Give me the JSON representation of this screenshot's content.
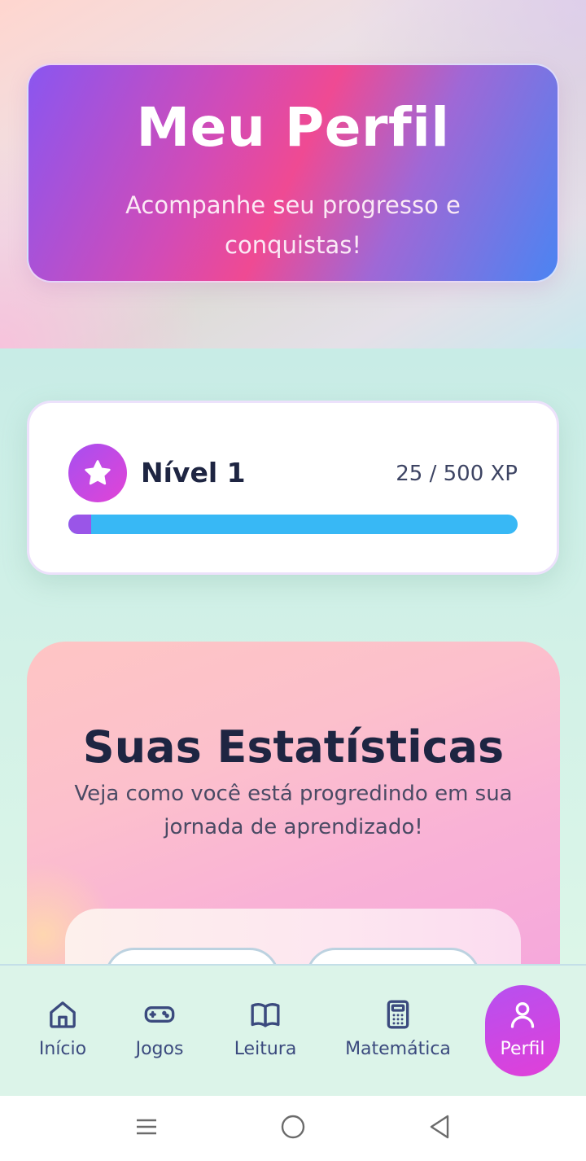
{
  "header": {
    "title": "Meu Perfil",
    "subtitle": "Acompanhe seu progresso e conquistas!"
  },
  "level": {
    "label": "Nível 1",
    "xp_text": "25 / 500 XP",
    "xp_current": 25,
    "xp_max": 500,
    "icon": "star-icon"
  },
  "stats": {
    "title": "Suas Estatísticas",
    "subtitle": "Veja como você está progredindo em sua jornada de aprendizado!"
  },
  "bottom_nav": {
    "items": [
      {
        "label": "Início",
        "icon": "home-icon",
        "active": false
      },
      {
        "label": "Jogos",
        "icon": "gamepad-icon",
        "active": false
      },
      {
        "label": "Leitura",
        "icon": "book-icon",
        "active": false
      },
      {
        "label": "Matemática",
        "icon": "calculator-icon",
        "active": false
      },
      {
        "label": "Perfil",
        "icon": "user-icon",
        "active": true
      }
    ]
  },
  "colors": {
    "accent_purple": "#a64ff0",
    "accent_pink": "#e244d6",
    "xp_bar": "#38b8f5",
    "text_dark": "#1e2542"
  }
}
